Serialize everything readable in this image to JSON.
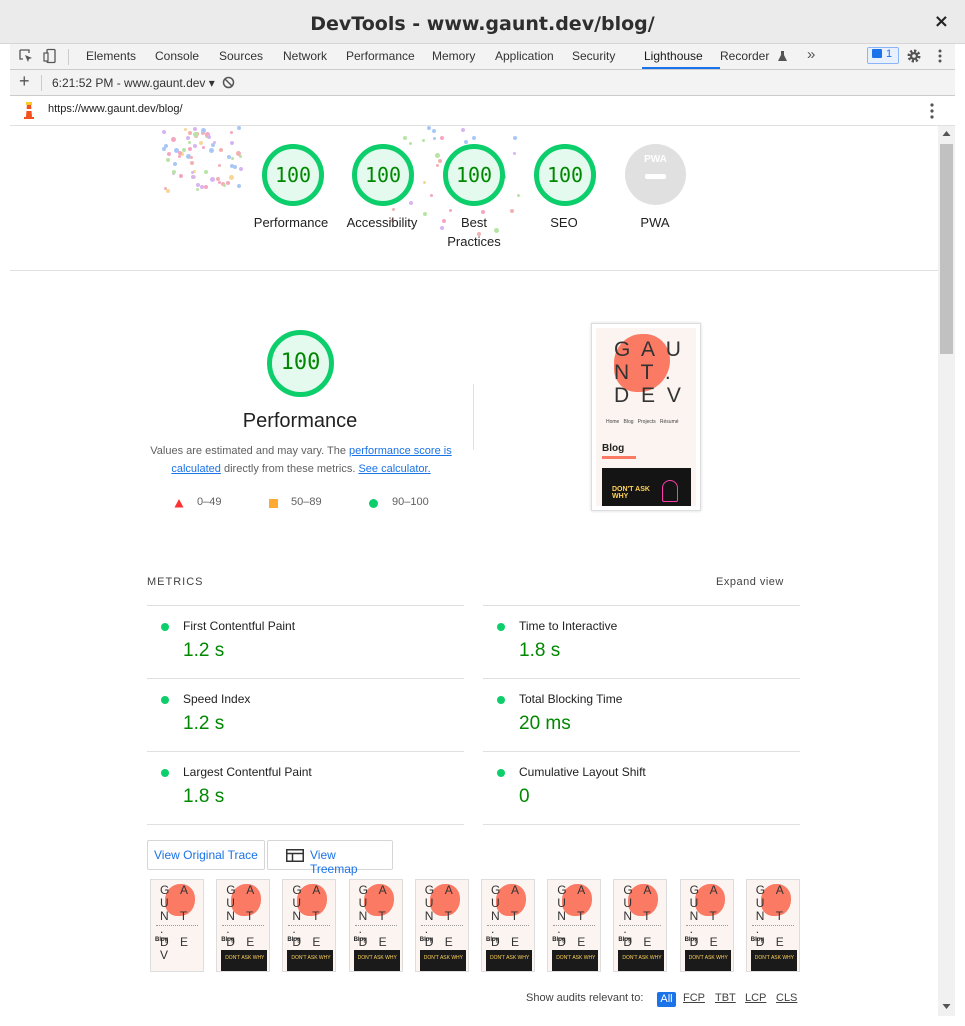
{
  "window": {
    "title": "DevTools - www.gaunt.dev/blog/",
    "close": "×"
  },
  "tabs": [
    "Elements",
    "Console",
    "Sources",
    "Network",
    "Performance",
    "Memory",
    "Application",
    "Security",
    "Lighthouse",
    "Recorder"
  ],
  "selected_tab": "Lighthouse",
  "issues_count": "1",
  "toolbar": {
    "report": "6:21:52 PM - www.gaunt.dev ▾"
  },
  "url": "https://www.gaunt.dev/blog/",
  "summary": [
    {
      "score": "100",
      "label": "Performance"
    },
    {
      "score": "100",
      "label": "Accessibility"
    },
    {
      "score": "100",
      "label": "Best Practices"
    },
    {
      "score": "100",
      "label": "SEO"
    }
  ],
  "pwa": {
    "label": "PWA",
    "badge": "PWA"
  },
  "performance": {
    "score": "100",
    "title": "Performance",
    "desc_prefix": "Values are estimated and may vary. The ",
    "link1": "performance score is calculated",
    "desc_mid": " directly from these metrics. ",
    "link2": "See calculator.",
    "legend": [
      {
        "range": "0–49",
        "color": "#ff3333"
      },
      {
        "range": "50–89",
        "color": "#ffaa33"
      },
      {
        "range": "90–100",
        "color": "#0cce6b"
      }
    ]
  },
  "screenshot": {
    "logo_line1": "G A U",
    "logo_line2": "N T .",
    "logo_line3": "D E V",
    "nav": "Home   Blog   Projects   Résumé",
    "heading": "Blog",
    "image_text": "DON'T ASK WHY"
  },
  "metrics": {
    "title": "METRICS",
    "expand": "Expand view",
    "items": [
      {
        "name": "First Contentful Paint",
        "value": "1.2 s"
      },
      {
        "name": "Time to Interactive",
        "value": "1.8 s"
      },
      {
        "name": "Speed Index",
        "value": "1.2 s"
      },
      {
        "name": "Total Blocking Time",
        "value": "20 ms"
      },
      {
        "name": "Largest Contentful Paint",
        "value": "1.8 s"
      },
      {
        "name": "Cumulative Layout Shift",
        "value": "0"
      }
    ]
  },
  "buttons": {
    "trace": "View Original Trace",
    "treemap": "View Treemap"
  },
  "filter": {
    "label": "Show audits relevant to:",
    "options": [
      "All",
      "FCP",
      "TBT",
      "LCP",
      "CLS"
    ],
    "selected": "All"
  },
  "colors": {
    "pass": "#0cce6b",
    "pass_text": "#008800",
    "accent": "#1a73e8",
    "coral": "#fa7a64"
  }
}
